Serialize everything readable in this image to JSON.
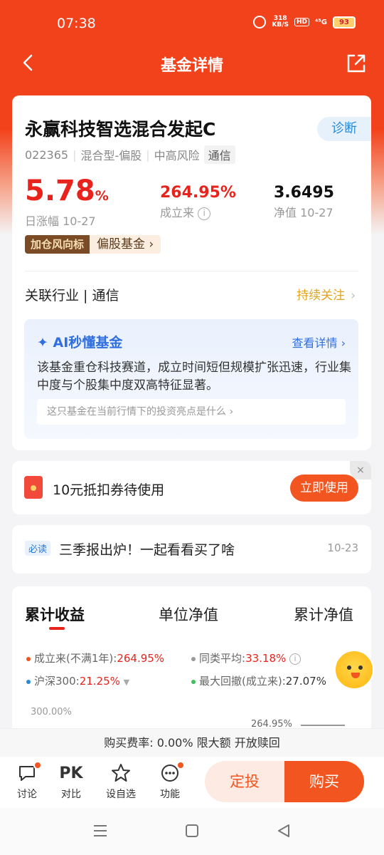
{
  "status_bar": {
    "time": "07:38",
    "net_speed_value": "318",
    "net_speed_unit": "KB/S",
    "hd": "HD",
    "signal": "⁴⁵G",
    "battery": "93"
  },
  "header": {
    "title": "基金详情"
  },
  "fund": {
    "name": "永赢科技智选混合发起C",
    "diagnose_label": "诊断",
    "code": "022365",
    "type": "混合型-偏股",
    "risk": "中高风险",
    "sector_tag": "通信",
    "daily_change": "5.78",
    "daily_change_unit": "%",
    "daily_change_label": "日涨幅 10-27",
    "since_inception": "264.95%",
    "since_inception_label": "成立来",
    "nav": "3.6495",
    "nav_label": "净值 10-27",
    "badge_brand": "加仓风向标",
    "badge_label": "偏股基金",
    "industry": "关联行业 | 通信",
    "follow_label": "持续关注"
  },
  "ai": {
    "title": "AI秒懂基金",
    "more": "查看详情",
    "summary": "该基金重仓科技赛道，成立时间短但规模扩张迅速，行业集中度与个股集中度双高特征显著。",
    "question": "这只基金在当前行情下的投资亮点是什么"
  },
  "coupon": {
    "text": "10元抵扣券待使用",
    "button": "立即使用",
    "close": "×"
  },
  "news": {
    "tag": "必读",
    "title": "三季报出炉！一起看看买了啥",
    "date": "10-23"
  },
  "chart_tabs": [
    "累计收益",
    "单位净值",
    "累计净值"
  ],
  "legend": {
    "fund_label": "成立来(不满1年):",
    "fund_value": "264.95%",
    "peer_label": "同类平均:",
    "peer_value": "33.18%",
    "hs300_label": "沪深300:",
    "hs300_value": "21.25%",
    "drawdown_label": "最大回撤(成立来):",
    "drawdown_value": "27.07%"
  },
  "chart_data": {
    "type": "line",
    "y_axis_top_label": "300.00%",
    "series": [
      {
        "name": "成立来(不满1年)",
        "last_value_label": "264.95%"
      }
    ]
  },
  "fee_bar": "购买费率: 0.00%  限大额  开放赎回",
  "bottom_nav": [
    {
      "label": "讨论",
      "icon": "chat-icon"
    },
    {
      "label": "对比",
      "icon": "pk-icon",
      "glyph": "PK"
    },
    {
      "label": "设自选",
      "icon": "star-add-icon"
    },
    {
      "label": "功能",
      "icon": "more-icon"
    }
  ],
  "buttons": {
    "fixed_invest": "定投",
    "buy": "购买"
  },
  "colors": {
    "brand": "#f2421c",
    "up": "#e8231b",
    "ai_blue": "#2f6fe0",
    "action": "#f2551f"
  }
}
